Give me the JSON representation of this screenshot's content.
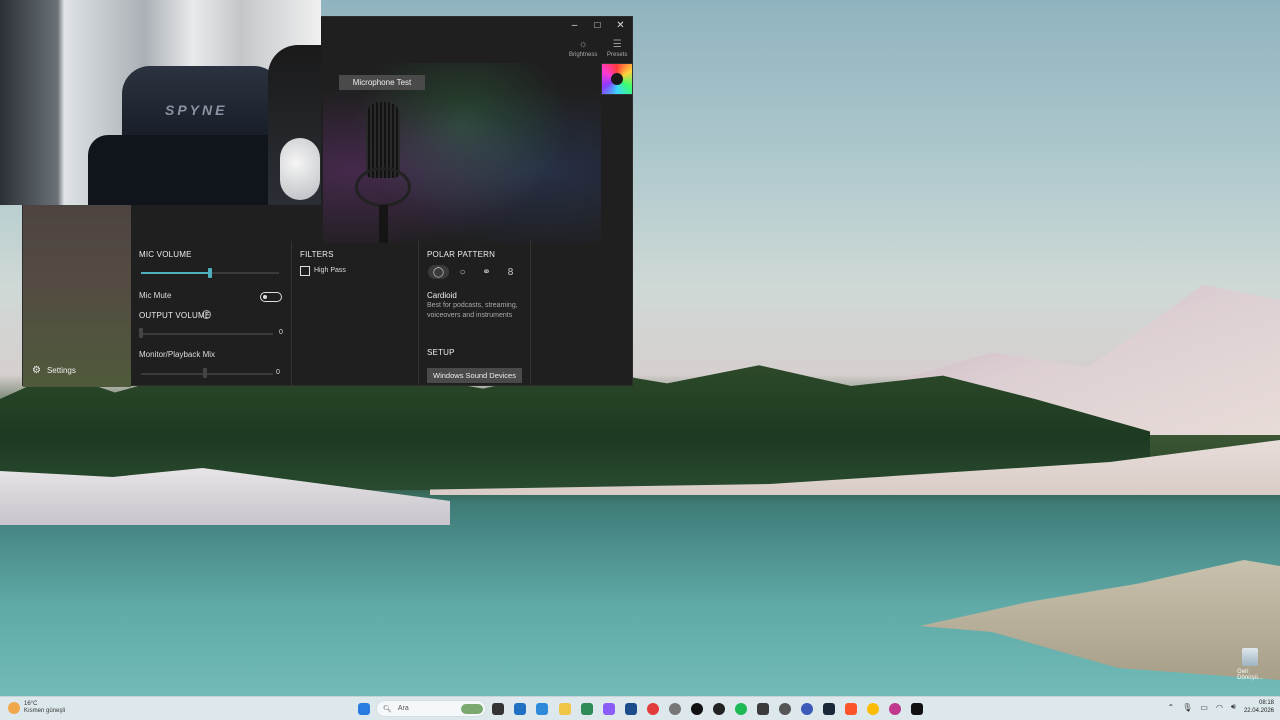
{
  "webcam": {
    "chair_brand": "SPYNE"
  },
  "window": {
    "controls": {
      "minimize": "–",
      "maximize": "□",
      "close": "✕"
    },
    "toolbar": {
      "brightness_label": "Brightness",
      "presets_label": "Presets"
    },
    "mic_test_label": "Microphone Test",
    "sidebar": {
      "settings_label": "Settings"
    },
    "mic_volume": {
      "title": "MIC VOLUME",
      "level": 0.5
    },
    "mic_mute": {
      "label": "Mic Mute",
      "on": false
    },
    "output_volume": {
      "title": "OUTPUT VOLUME",
      "help": "?",
      "value": "0"
    },
    "monitor_mix": {
      "label": "Monitor/Playback Mix",
      "value": "0"
    },
    "filters": {
      "title": "FILTERS",
      "high_pass_label": "High Pass",
      "high_pass_checked": false
    },
    "polar_pattern": {
      "title": "POLAR PATTERN",
      "options": [
        "cardioid",
        "omnidirectional",
        "stereo",
        "bidirectional"
      ],
      "selected": "cardioid",
      "selected_name": "Cardioid",
      "selected_description": "Best for podcasts, streaming, voiceovers and instruments"
    },
    "setup": {
      "title": "SETUP",
      "button_label": "Windows Sound Devices"
    },
    "accent_color": "#4fb0bd"
  },
  "taskbar": {
    "weather": {
      "temp": "16°C",
      "condition": "Kısmen güneşli"
    },
    "search_placeholder": "Ara",
    "clock": {
      "time": "08:18",
      "date": "22.04.2026"
    }
  },
  "desktop": {
    "recycle_bin_label": "Geri Dönüşü..."
  }
}
